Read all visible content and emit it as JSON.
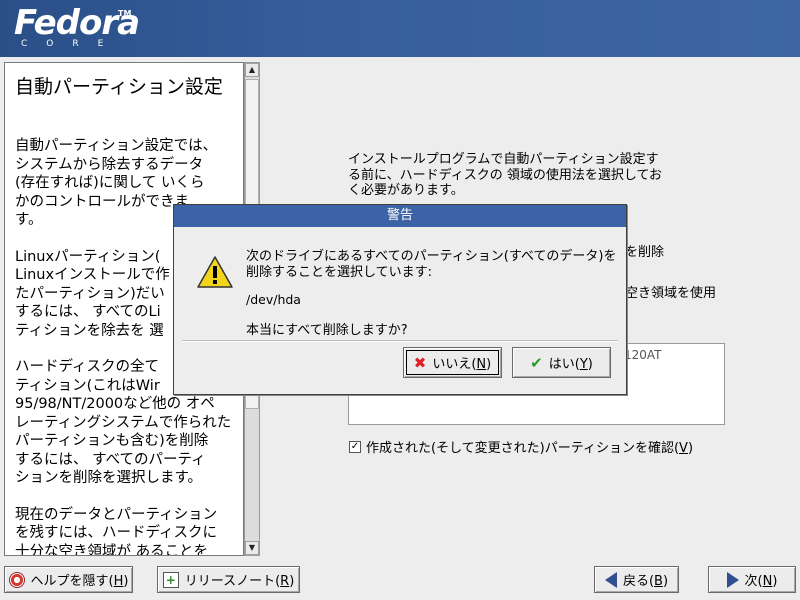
{
  "brand": {
    "name": "Fedora",
    "tm": "TM",
    "sub": "CORE"
  },
  "help": {
    "title": "自動パーティション設定",
    "paragraphs": [
      "自動パーティション設定では、\nシステムから除去するデータ\n(存在すれば)に関して いくら\nかのコントロールができま\nす。",
      "Linuxパーティション(\nLinuxインストールで作\nたパーティション)だい\nするには、 すべてのLi\nティションを除去を 選",
      "ハードディスクの全て\nティション(これはWir\n95/98/NT/2000など他の オペ\nレーティングシステムで作られた\nパーティションも含む)を削除\nするには、 すべてのパーティ\nションを削除を選択します。",
      "現在のデータとパーティション\nを残すには、ハードディスクに\n十分な空き領域が あることを\n確認した上で、すべてのパ"
    ]
  },
  "main": {
    "intro": "インストールプログラムで自動パーティション設定する前に、ハードディスクの 領域の使用法を選択しておく必要があります。",
    "option1_visible": "を削除",
    "option2_visible": "空き領域を使用",
    "drive_visible": "120AT",
    "review_label": "作成された(そして変更された)パーティションを確認(",
    "review_key": "V",
    "review_close": ")",
    "review_checked": "✓"
  },
  "dialog": {
    "title": "警告",
    "message": "次のドライブにあるすべてのパーティション(すべてのデータ)を削除することを選択しています:",
    "device": "/dev/hda",
    "confirm": "本当にすべて削除しますか?",
    "no_label": "いいえ(",
    "no_key": "N",
    "yes_label": "はい(",
    "yes_key": "Y",
    "close_paren": ")"
  },
  "buttons": {
    "help_label": "ヘルプを隠す(",
    "help_key": "H",
    "notes_label": "リリースノート(",
    "notes_key": "R",
    "back_label": "戻る(",
    "back_key": "B",
    "next_label": "次(",
    "next_key": "N",
    "close_paren": ")"
  },
  "colors": {
    "header": "#355e9b",
    "dialog_title": "#3c63a6",
    "warning": "#f2d41a"
  }
}
